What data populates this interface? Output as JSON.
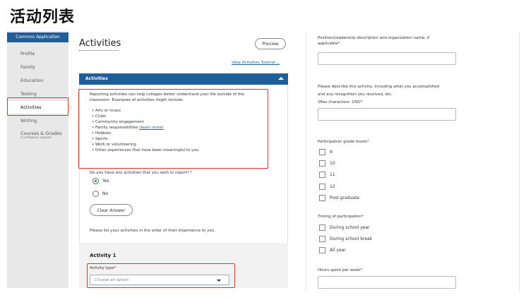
{
  "heading": "活动列表",
  "sidebar": {
    "header": "Common Application",
    "items": [
      {
        "label": "Profile"
      },
      {
        "label": "Family"
      },
      {
        "label": "Education"
      },
      {
        "label": "Testing"
      },
      {
        "label": "Activities"
      },
      {
        "label": "Writing"
      },
      {
        "label": "Courses & Grades"
      }
    ],
    "courses_sub": "4 college(s) require"
  },
  "main": {
    "title": "Activities",
    "preview_label": "Preview",
    "tutorial_link": "View Activities Tutorial",
    "section_title": "Activities",
    "intro": "Reporting activities can help colleges better understand your life outside of the classroom. Examples of activities might include:",
    "examples": [
      "Arts or music",
      "Clubs",
      "Community engagement",
      "Family responsibilities",
      "Hobbies",
      "Sports",
      "Work or volunteering",
      "Other experiences that have been meaningful to you"
    ],
    "learn_more": "(learn more)",
    "report_question": "Do you have any activities that you wish to report?",
    "options": [
      "Yes",
      "No"
    ],
    "selected_option": "Yes",
    "clear_label": "Clear Answer",
    "order_note": "Please list your activities in the order of their importance to you.",
    "activity_title": "Activity 1",
    "activity_type_label": "Activity type",
    "activity_type_placeholder": "Choose an option",
    "required_marker": "*"
  },
  "right": {
    "position_label": "Position/Leadership description and organization name, if applicable",
    "describe_label_1": "Please describe this activity, including what you accomplished",
    "describe_label_2": "and any recognition you received, etc.",
    "describe_label_3": "(Max characters: 150)",
    "grade_label": "Participation grade levels",
    "grades": [
      "9",
      "10",
      "11",
      "12",
      "Post-graduate"
    ],
    "timing_label": "Timing of participation",
    "timings": [
      "During school year",
      "During school break",
      "All year"
    ],
    "hours_label": "Hours spent per week"
  },
  "colors": {
    "brand_blue": "#1f5f99",
    "highlight_red": "#e03030",
    "selected_green": "#3a8a3a"
  }
}
